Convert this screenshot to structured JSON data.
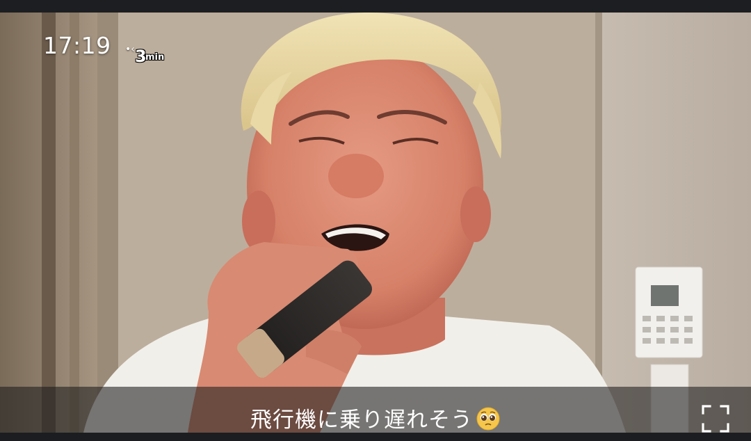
{
  "overlay": {
    "clock": "17:19",
    "timer_icon": "rewind-arrow-icon",
    "timer_value": "3",
    "timer_unit": "min"
  },
  "caption": {
    "text": "飛行機に乗り遅れそう",
    "emoji": "pleading-face-emoji"
  },
  "controls": {
    "fullscreen_icon": "fullscreen-icon"
  },
  "colors": {
    "caption_band": "#1e1e1e",
    "caption_text": "#ffffff",
    "hair": "#e8d7a2",
    "wall": "#b7aa9a"
  }
}
